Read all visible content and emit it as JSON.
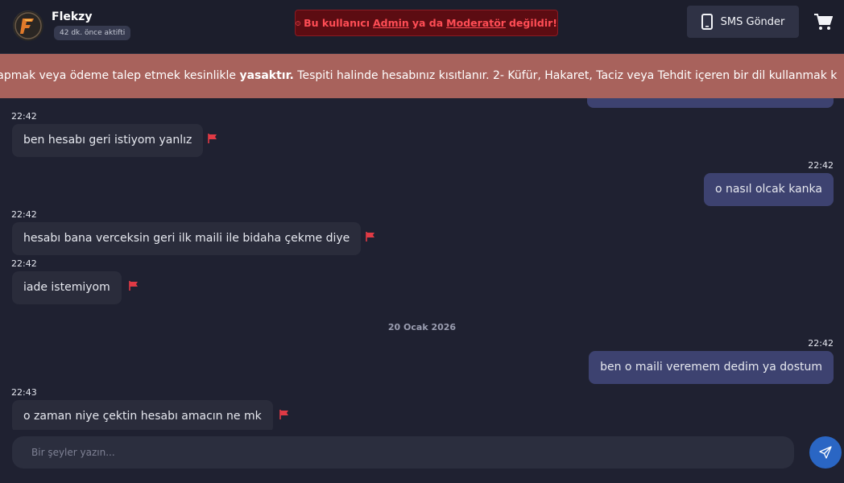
{
  "header": {
    "user_name": "Flekzy",
    "user_status": "42 dk. önce aktifti",
    "warning": {
      "prefix": "Bu kullanıcı",
      "role1": "Admin",
      "middle": "ya da",
      "role2": "Moderatör",
      "suffix": "değildir!"
    },
    "sms_label": "SMS Gönder",
    "icons": {
      "avatar": "avatar-logo-icon",
      "warning": "info-circle-icon",
      "sms": "mobile-phone-icon",
      "cart": "shopping-cart-icon"
    }
  },
  "ticker": {
    "part1": "yapmak veya ödeme talep etmek kesinlikle",
    "bold": "yasaktır.",
    "part2": "Tespiti halinde hesabınız kısıtlanır. 2- Küfür, Hakaret, Taciz veya Tehdit içeren bir dil kullanmak k"
  },
  "messages": [
    {
      "time": "22:42",
      "text": "ben hesabı geri istiyom yanlız",
      "side": "in"
    },
    {
      "time": "22:42",
      "text": "o nasıl olcak kanka",
      "side": "out"
    },
    {
      "time": "22:42",
      "text": "hesabı bana verceksin geri ilk maili ile bidaha çekme diye",
      "side": "in"
    },
    {
      "time": "22:42",
      "text": "iade istemiyom",
      "side": "in"
    },
    {
      "time": "22:42",
      "text": "ben o maili veremem dedim ya dostum",
      "side": "out"
    },
    {
      "time": "22:43",
      "text": "o zaman niye çektin hesabı amacın ne mk",
      "side": "in"
    }
  ],
  "date_separator": "20 Ocak 2026",
  "composer": {
    "placeholder": "Bir şeyler yazın...",
    "send_icon": "paper-plane-icon"
  },
  "colors": {
    "background": "#1f2131",
    "incoming_bubble": "#2a2c3b",
    "outgoing_bubble": "#3d4270",
    "ticker": "#a8625c",
    "warning_text": "#ff4d55",
    "flag": "#e03a45",
    "send_button": "#2a66c4"
  }
}
